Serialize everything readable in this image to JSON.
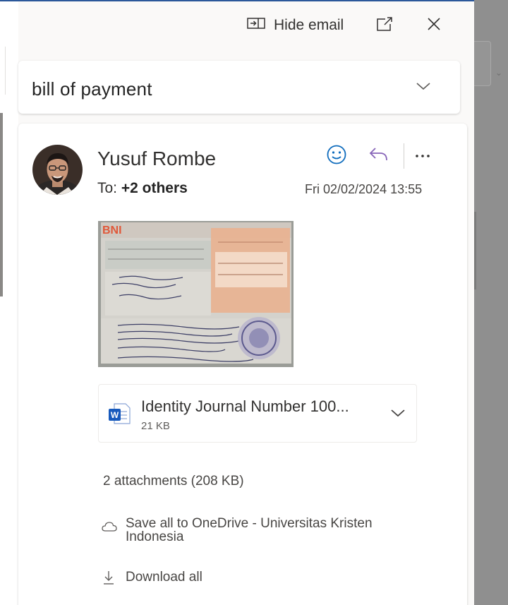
{
  "toolbar": {
    "hide_email_label": "Hide email",
    "icons": [
      "hide-email-icon",
      "pop-out-icon",
      "close-icon"
    ]
  },
  "subject": {
    "text": "bill of payment"
  },
  "message": {
    "sender_name": "Yusuf Rombe",
    "to_prefix": "To:",
    "to_recipients": "+2 others",
    "date": "Fri 02/02/2024 13:55",
    "actions": [
      "emoji-reaction-icon",
      "reply-icon",
      "more-options-icon"
    ]
  },
  "receipt_image": {
    "bank_logo_text": "BNI"
  },
  "attachment": {
    "file_name": "Identity Journal Number 100...",
    "file_size": "21 KB",
    "file_type_icon": "word-doc-icon"
  },
  "attachments_summary": {
    "count_label": "2 attachments (208 KB)",
    "onedrive_label": "Save all to OneDrive - Universitas Kristen Indonesia",
    "download_label": "Download all"
  },
  "colors": {
    "accent_blue": "#2b579a",
    "emoji_blue": "#0f6cbd",
    "reply_purple": "#8764b8",
    "word_blue": "#185abd"
  }
}
